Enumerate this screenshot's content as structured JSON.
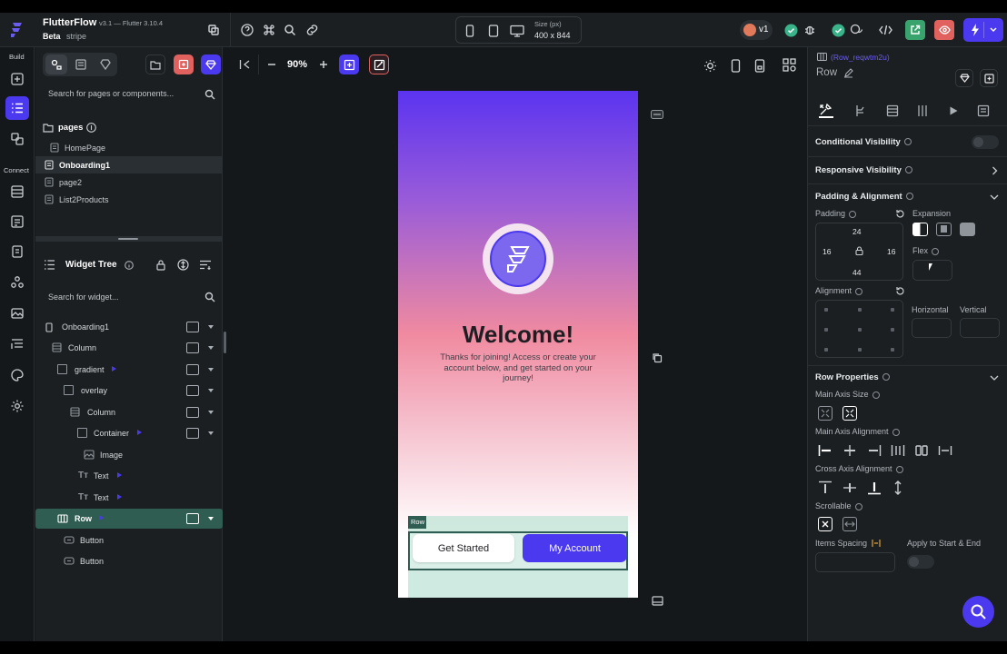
{
  "app": {
    "name": "FlutterFlow",
    "version": "v3.1 — Flutter 3.10.4",
    "badge": "Beta",
    "project": "stripe"
  },
  "device": {
    "size_label": "Size (px)",
    "size_value": "400 x 844"
  },
  "toolbar_right": {
    "version_label": "v1"
  },
  "rail": {
    "build_label": "Build",
    "connect_label": "Connect"
  },
  "left": {
    "search_pages_placeholder": "Search for pages or components...",
    "pages_label": "pages",
    "pages": [
      "HomePage",
      "Onboarding1",
      "page2",
      "List2Products"
    ],
    "widget_tree_label": "Widget Tree",
    "search_widget_placeholder": "Search for widget...",
    "tree": [
      "Onboarding1",
      "Column",
      "gradient",
      "overlay",
      "Column",
      "Container",
      "Image",
      "Text",
      "Text",
      "Row",
      "Button",
      "Button"
    ]
  },
  "canvas": {
    "zoom": "90%",
    "welcome": "Welcome!",
    "subtitle": "Thanks for joining! Access or create your account below, and get started on your journey!",
    "row_tag": "Row",
    "btn_get_started": "Get Started",
    "btn_my_account": "My Account"
  },
  "props": {
    "widget_id": "(Row_reqwtm2u)",
    "widget_type": "Row",
    "conditional_visibility": "Conditional Visibility",
    "responsive_visibility": "Responsive Visibility",
    "padding_alignment": "Padding & Alignment",
    "padding_label": "Padding",
    "padding_top": "24",
    "padding_left": "16",
    "padding_right": "16",
    "padding_bottom": "44",
    "expansion_label": "Expansion",
    "flex_label": "Flex",
    "alignment_label": "Alignment",
    "horizontal_label": "Horizontal",
    "vertical_label": "Vertical",
    "row_properties": "Row Properties",
    "main_axis_size": "Main Axis Size",
    "main_axis_alignment": "Main Axis Alignment",
    "cross_axis_alignment": "Cross Axis Alignment",
    "scrollable": "Scrollable",
    "items_spacing": "Items Spacing",
    "apply_start_end": "Apply to Start & End"
  },
  "colors": {
    "accent": "#4b39ef",
    "selected_row": "#2f5d52",
    "gradient_top": "#5b34f0",
    "gradient_mid": "#f08aa0"
  }
}
